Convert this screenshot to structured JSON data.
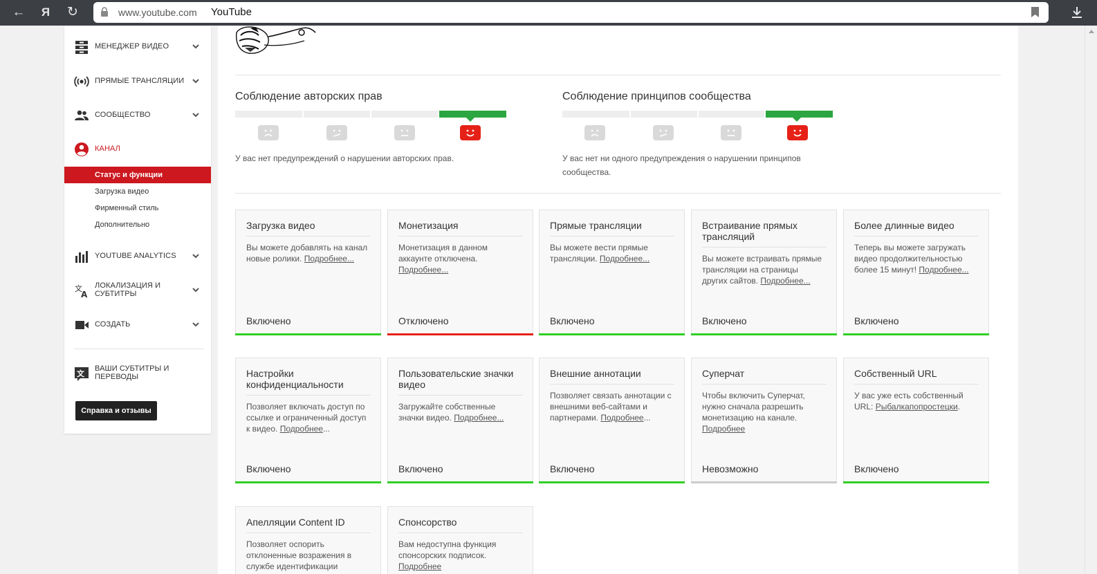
{
  "browser": {
    "domain": "www.youtube.com",
    "title": "YouTube",
    "back_glyph": "←",
    "yandex_glyph": "Я",
    "reload_glyph": "↻"
  },
  "sidebar": {
    "items": [
      {
        "label": "МЕНЕДЖЕР ВИДЕО",
        "icon": "video-manager-icon"
      },
      {
        "label": "ПРЯМЫЕ ТРАНСЛЯЦИИ",
        "icon": "live-broadcast-icon"
      },
      {
        "label": "СООБЩЕСТВО",
        "icon": "community-icon"
      },
      {
        "label": "КАНАЛ",
        "icon": "channel-icon"
      },
      {
        "label": "YOUTUBE ANALYTICS",
        "icon": "analytics-icon"
      },
      {
        "label_line1": "ЛОКАЛИЗАЦИЯ И",
        "label_line2": "СУБТИТРЫ",
        "icon": "translate-icon"
      },
      {
        "label": "СОЗДАТЬ",
        "icon": "create-icon"
      }
    ],
    "channel_sub": [
      "Статус и функции",
      "Загрузка видео",
      "Фирменный стиль",
      "Дополнительно"
    ],
    "subtitles_line1": "ВАШИ СУБТИТРЫ И",
    "subtitles_line2": "ПЕРЕВОДЫ",
    "help_button": "Справка и отзывы",
    "accent_color": "#cc181e"
  },
  "copyright": {
    "title": "Соблюдение авторских прав",
    "status": "У вас нет предупреждений о нарушении авторских прав."
  },
  "community": {
    "title": "Соблюдение принципов сообщества",
    "status_line1": "У вас нет ни одного предупреждения о нарушении принципов",
    "status_line2": "сообщества."
  },
  "cards": [
    {
      "title": "Загрузка видео",
      "desc1": "Вы можете добавлять на канал",
      "desc2": "новые ролики. ",
      "link": "Подробнее...",
      "status": "Включено",
      "bar": "green"
    },
    {
      "title": "Монетизация",
      "desc1": "Монетизация в данном",
      "desc2": "аккаунте отключена.",
      "link": "Подробнее...",
      "status": "Отключено",
      "bar": "red"
    },
    {
      "title": "Прямые трансляции",
      "desc1": "Вы можете вести прямые",
      "desc2": "трансляции. ",
      "link": "Подробнее...",
      "status": "Включено",
      "bar": "green"
    },
    {
      "title_line1": "Встраивание прямых",
      "title_line2": "трансляций",
      "desc1": "Вы можете встраивать прямые",
      "desc2": "трансляции на страницы",
      "desc3": "других сайтов. ",
      "link": "Подробнее...",
      "status": "Включено",
      "bar": "green"
    },
    {
      "title": "Более длинные видео",
      "desc1": "Теперь вы можете загружать",
      "desc2": "видео продолжительностью",
      "desc3": "более 15 минут! ",
      "link": "Подробнее...",
      "status": "Включено",
      "bar": "green"
    },
    {
      "title_line1": "Настройки",
      "title_line2": "конфиденциальности",
      "desc1": "Позволяет включать доступ по",
      "desc2": "ссылке и ограниченный доступ",
      "desc3": "к видео. ",
      "link": "Подробнее",
      "link_suffix": "...",
      "status": "Включено",
      "bar": "green"
    },
    {
      "title_line1": "Пользовательские значки",
      "title_line2": "видео",
      "desc1": "Загружайте собственные",
      "desc2": "значки видео. ",
      "link": "Подробнее...",
      "status": "Включено",
      "bar": "green"
    },
    {
      "title": "Внешние аннотации",
      "desc1": "Позволяет связать аннотации с",
      "desc2": "внешними веб-сайтами и",
      "desc3": "партнерами. ",
      "link": "Подробнее",
      "link_suffix": "...",
      "status": "Включено",
      "bar": "green"
    },
    {
      "title": "Суперчат",
      "desc1": "Чтобы включить Суперчат,",
      "desc2": "нужно сначала разрешить",
      "desc3": "монетизацию на канале.",
      "link": "Подробнее",
      "status": "Невозможно",
      "bar": "gray"
    },
    {
      "title": "Собственный URL",
      "desc1": "У вас уже есть собственный",
      "desc2": "URL: ",
      "link": "Рыбалкапопростецки",
      "link_suffix": ".",
      "status": "Включено",
      "bar": "green"
    },
    {
      "title": "Апелляции Content ID",
      "desc1": "Позволяет оспорить",
      "desc2": "отклоненные возражения в",
      "desc3": "службе идентификации",
      "status": "",
      "bar": "none"
    },
    {
      "title": "Спонсорство",
      "desc1": "Вам недоступна функция",
      "desc2": "спонсорских подписок.",
      "link": "Подробнее",
      "status": "",
      "bar": "none"
    }
  ]
}
